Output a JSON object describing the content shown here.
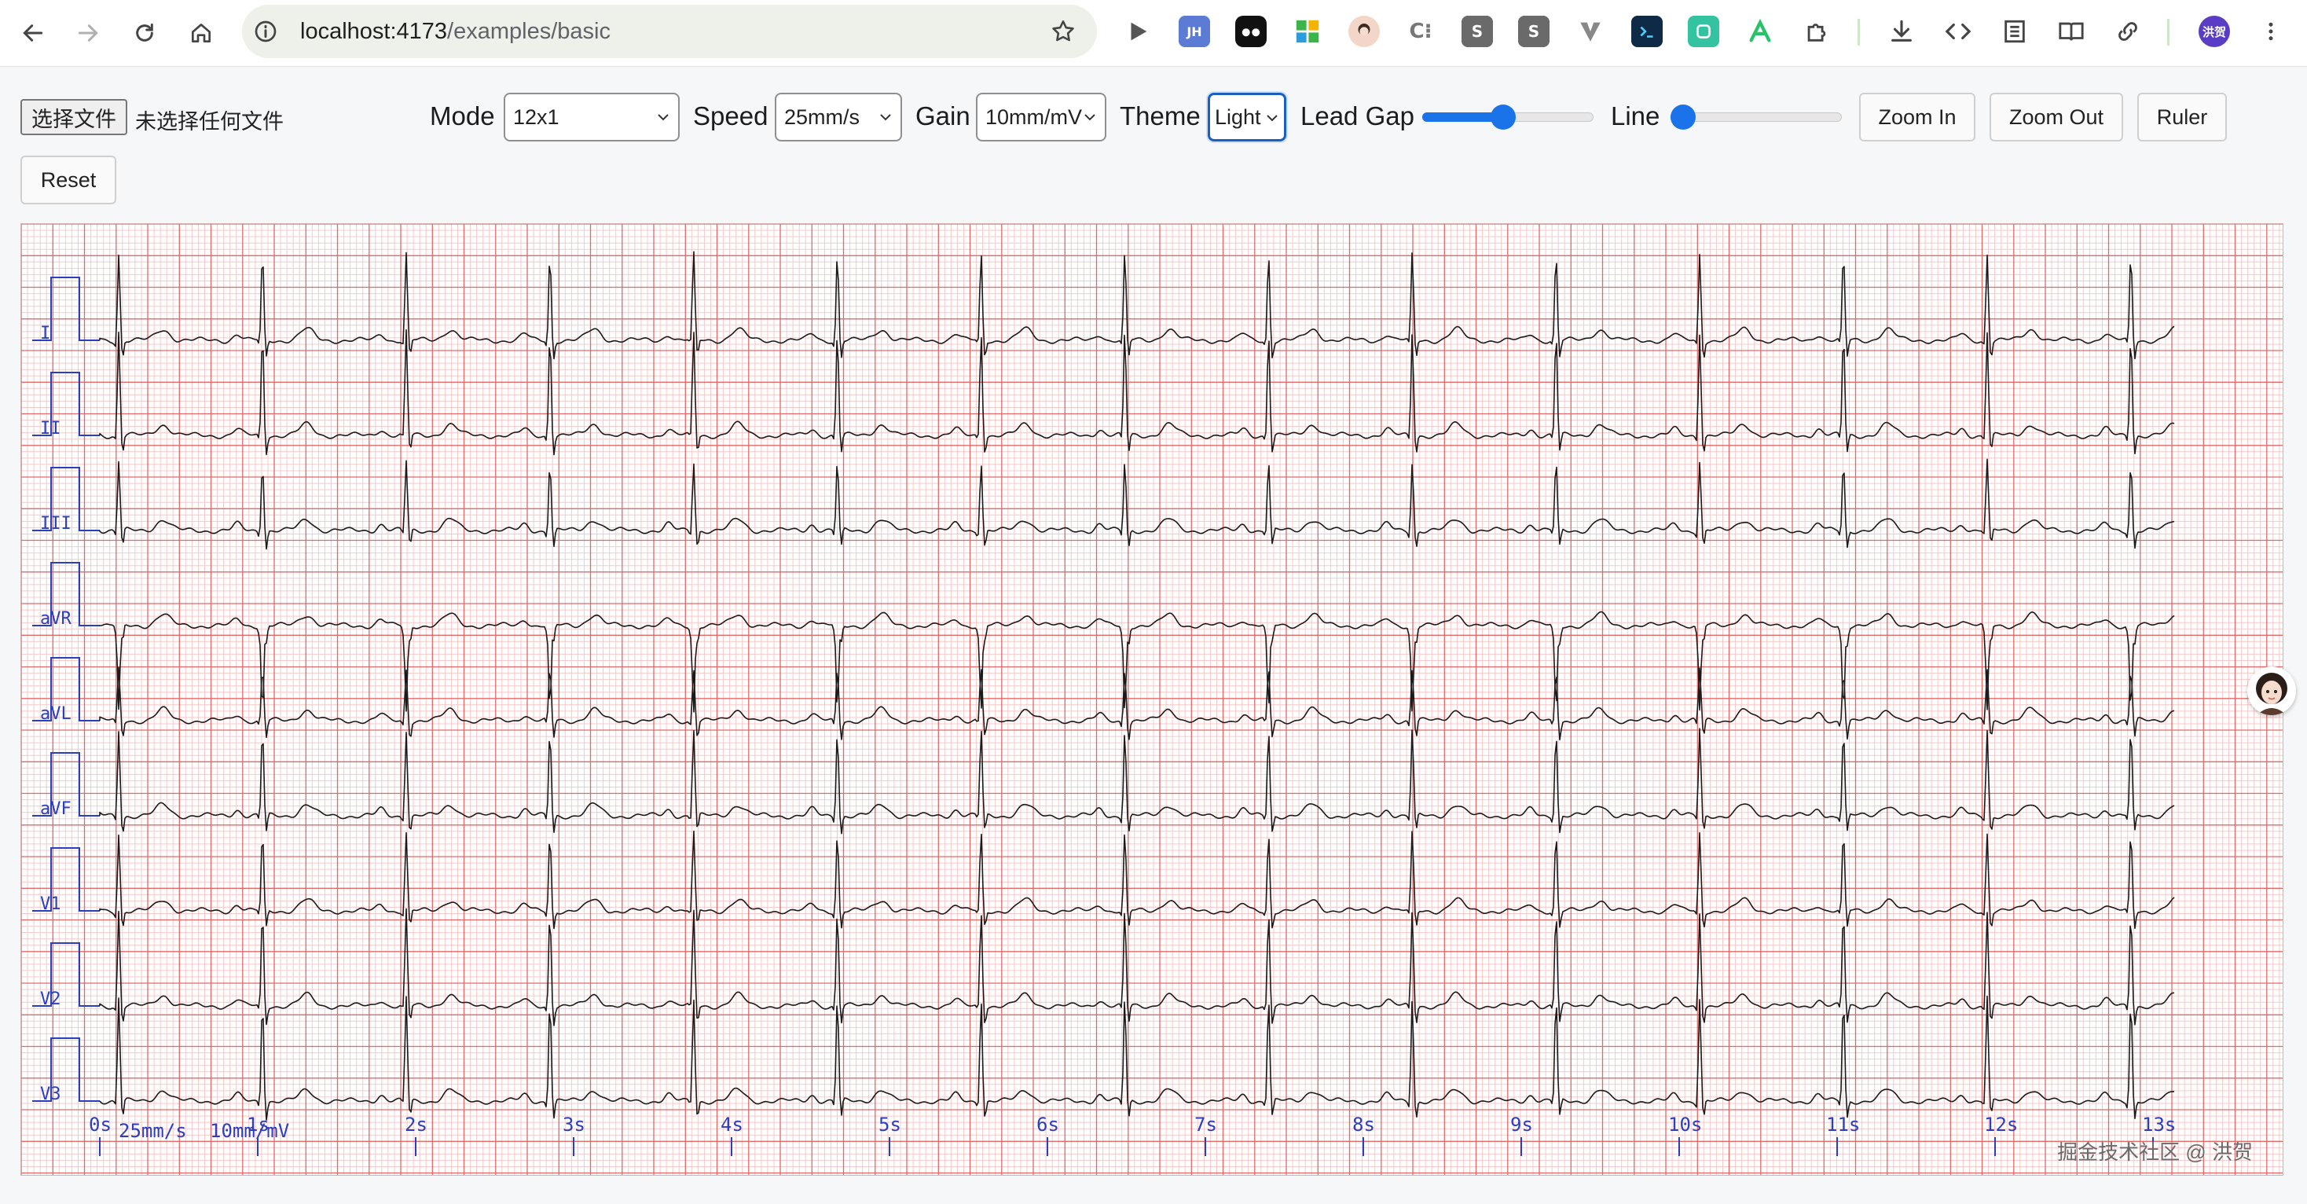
{
  "browser": {
    "url_host": "localhost:4173",
    "url_path": "/examples/basic",
    "profile_initials": "洪贺"
  },
  "toolbar": {
    "file_button": "选择文件",
    "file_status": "未选择任何文件",
    "mode_label": "Mode",
    "mode_value": "12x1",
    "speed_label": "Speed",
    "speed_value": "25mm/s",
    "gain_label": "Gain",
    "gain_value": "10mm/mV",
    "theme_label": "Theme",
    "theme_value": "Light",
    "lead_gap_label": "Lead Gap",
    "lead_gap_level": 0.47,
    "line_label": "Line",
    "line_level": 0.0,
    "zoom_in": "Zoom In",
    "zoom_out": "Zoom Out",
    "ruler": "Ruler",
    "reset": "Reset"
  },
  "ecg": {
    "leads": [
      "I",
      "II",
      "III",
      "aVR",
      "aVL",
      "aVF",
      "V1",
      "V2",
      "V3"
    ],
    "speed_annotation": "25mm/s",
    "gain_annotation": "10mm/mV",
    "time_labels": [
      "0s",
      "1s",
      "2s",
      "3s",
      "4s",
      "5s",
      "6s",
      "7s",
      "8s",
      "9s",
      "10s",
      "11s",
      "12s",
      "13s"
    ],
    "colors": {
      "minor_grid": "#f6c9c9",
      "major_grid": "#e06a6a",
      "trace": "#1a1a1a",
      "annotation": "#2a3fbf"
    }
  },
  "watermark": "掘金技术社区 @ 洪贺"
}
